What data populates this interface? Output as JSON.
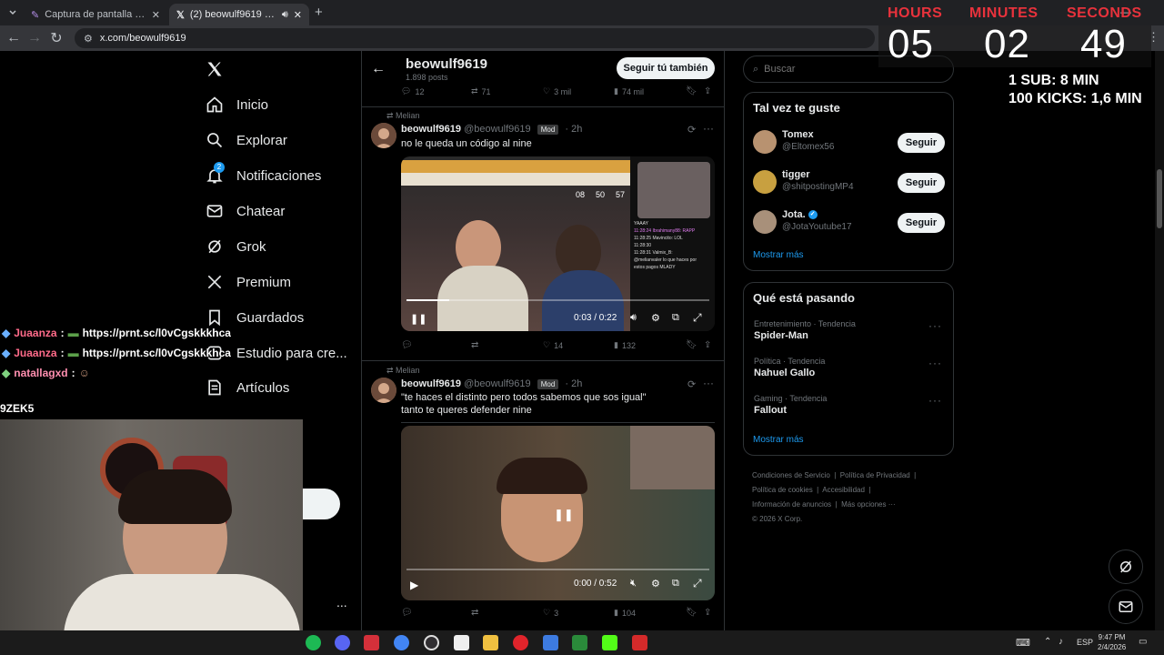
{
  "browser": {
    "tabs": [
      {
        "title": "Captura de pantalla por Lightsh",
        "active": false
      },
      {
        "title": "(2) beowulf9619 (@beowul",
        "active": true
      }
    ],
    "url": "x.com/beowulf9619"
  },
  "nav": {
    "items": [
      {
        "label": "Inicio",
        "icon": "home-icon"
      },
      {
        "label": "Explorar",
        "icon": "search-icon"
      },
      {
        "label": "Notificaciones",
        "icon": "bell-icon",
        "badge": "2"
      },
      {
        "label": "Chatear",
        "icon": "mail-icon"
      },
      {
        "label": "Grok",
        "icon": "grok-icon"
      },
      {
        "label": "Premium",
        "icon": "x-icon"
      },
      {
        "label": "Guardados",
        "icon": "bookmark-icon"
      },
      {
        "label": "Estudio para cre...",
        "icon": "studio-icon"
      },
      {
        "label": "Artículos",
        "icon": "article-icon"
      }
    ],
    "more": "..."
  },
  "profile": {
    "name": "beowulf9619",
    "posts": "1.898 posts",
    "follow_label": "Seguir tú también"
  },
  "top_actions": {
    "replies": "12",
    "reposts": "71",
    "likes": "3 mil",
    "views": "74 mil"
  },
  "tweets": [
    {
      "repost_by": "Melian",
      "name": "beowulf9619",
      "handle": "@beowulf9619",
      "badge": "Mod",
      "time": "2h",
      "text": [
        "no le queda un código al nine"
      ],
      "video": {
        "time": "0:03 / 0:22",
        "progress": 0.14,
        "playing": true,
        "overlay_timer": [
          "08",
          "50",
          "57"
        ],
        "chat_lines": [
          "YAAAY",
          "11:28:24 Ibrahimany88: RAPP",
          "11:28:25 Mavincito: LOL",
          "11:28:30",
          "11:28:31 Valmix_B:",
          "@melianvaler lo que haces por",
          "estos pagos MLADY"
        ]
      },
      "replies": "",
      "reposts": "",
      "likes": "14",
      "views": "132"
    },
    {
      "repost_by": "Melian",
      "name": "beowulf9619",
      "handle": "@beowulf9619",
      "badge": "Mod",
      "time": "2h",
      "text": [
        "\"te haces el distinto pero todos sabemos que sos igual\"",
        "tanto te queres defender nine"
      ],
      "video": {
        "time": "0:00 / 0:52",
        "progress": 0.0,
        "playing": false
      },
      "replies": "",
      "reposts": "",
      "likes": "3",
      "views": "104"
    }
  ],
  "search": {
    "placeholder": "Buscar"
  },
  "suggestions": {
    "title": "Tal vez te guste",
    "users": [
      {
        "name": "Tomex",
        "handle": "@Eltomex56",
        "verified": false,
        "button": "Seguir"
      },
      {
        "name": "tigger",
        "handle": "@shitpostingMP4",
        "verified": false,
        "button": "Seguir"
      },
      {
        "name": "Jota.",
        "handle": "@JotaYoutube17",
        "verified": true,
        "button": "Seguir"
      }
    ],
    "more": "Mostrar más"
  },
  "trends": {
    "title": "Qué está pasando",
    "items": [
      {
        "category": "Entretenimiento · Tendencia",
        "name": "Spider-Man"
      },
      {
        "category": "Política · Tendencia",
        "name": "Nahuel Gallo"
      },
      {
        "category": "Gaming · Tendencia",
        "name": "Fallout"
      }
    ],
    "more": "Mostrar más"
  },
  "footer": {
    "links": [
      "Condiciones de Servicio",
      "Política de Privacidad",
      "Política de cookies",
      "Accesibilidad",
      "Información de anuncios",
      "Más opciones ···"
    ],
    "copyright": "© 2026 X Corp."
  },
  "timer": {
    "labels": [
      "HOURS",
      "MINUTES",
      "SECONDS"
    ],
    "values": [
      "05",
      "02",
      "49"
    ],
    "rule1": "1 SUB: 8 MIN",
    "rule2": "100 KICKS: 1,6 MIN",
    "label_color": "#e8323c"
  },
  "chat": [
    {
      "user": "Juaanza",
      "sep": ":",
      "msg": "https://prnt.sc/l0vCgskkkhca",
      "color": "#ff6b8a"
    },
    {
      "user": "Juaanza",
      "sep": ":",
      "msg": "https://prnt.sc/l0vCgskkkhca",
      "color": "#ff6b8a"
    },
    {
      "user": "natallagxd",
      "sep": ":",
      "msg": "",
      "color": "#ff8fb0"
    }
  ],
  "chat_fragment": "9ZEK5",
  "taskbar": {
    "lang": "ESP",
    "time": "9:47 PM",
    "date": "2/4/2026"
  },
  "colors": {
    "accent": "#1d9bf0",
    "background": "#000000",
    "border": "#2f3336"
  }
}
